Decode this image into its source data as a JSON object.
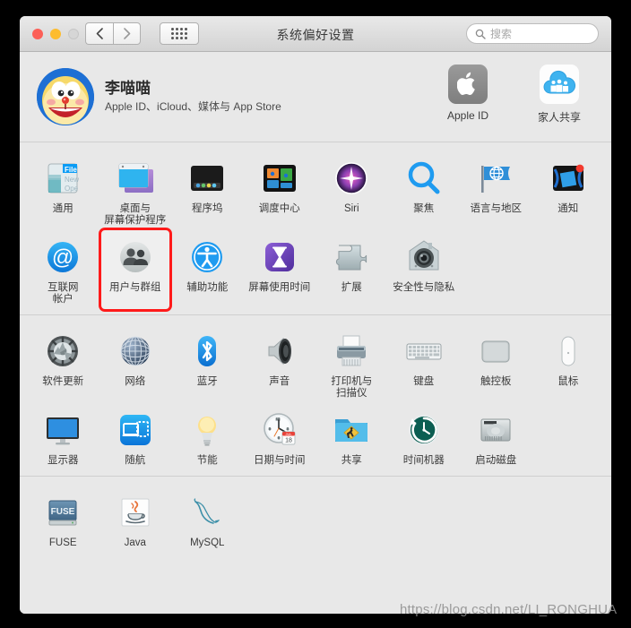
{
  "window": {
    "title": "系统偏好设置",
    "traffic_lights": [
      "close",
      "minimize",
      "zoom"
    ],
    "nav": {
      "back": "‹",
      "forward": "›",
      "grid": "show-all"
    },
    "search": {
      "placeholder": "搜索",
      "value": ""
    }
  },
  "account": {
    "name": "李喵喵",
    "subtitle": "Apple ID、iCloud、媒体与 App Store",
    "buttons": [
      {
        "label": "Apple ID",
        "icon": "apple-logo-icon"
      },
      {
        "label": "家人共享",
        "icon": "family-sharing-cloud-icon"
      }
    ]
  },
  "sections": [
    {
      "name": "personal",
      "items": [
        {
          "label": "通用",
          "icon": "general-icon",
          "highlight": false
        },
        {
          "label": "桌面与\n屏幕保护程序",
          "icon": "desktop-screensaver-icon",
          "highlight": false
        },
        {
          "label": "程序坞",
          "icon": "dock-icon",
          "highlight": false
        },
        {
          "label": "调度中心",
          "icon": "mission-control-icon",
          "highlight": false
        },
        {
          "label": "Siri",
          "icon": "siri-icon",
          "highlight": false
        },
        {
          "label": "聚焦",
          "icon": "spotlight-icon",
          "highlight": false
        },
        {
          "label": "语言与地区",
          "icon": "language-region-icon",
          "highlight": false
        },
        {
          "label": "通知",
          "icon": "notifications-icon",
          "highlight": false
        },
        {
          "label": "互联网\n帐户",
          "icon": "internet-accounts-icon",
          "highlight": false
        },
        {
          "label": "用户与群组",
          "icon": "users-groups-icon",
          "highlight": true
        },
        {
          "label": "辅助功能",
          "icon": "accessibility-icon",
          "highlight": false
        },
        {
          "label": "屏幕使用时间",
          "icon": "screen-time-icon",
          "highlight": false
        },
        {
          "label": "扩展",
          "icon": "extensions-icon",
          "highlight": false
        },
        {
          "label": "安全性与隐私",
          "icon": "security-privacy-icon",
          "highlight": false
        }
      ]
    },
    {
      "name": "hardware",
      "items": [
        {
          "label": "软件更新",
          "icon": "software-update-icon",
          "highlight": false
        },
        {
          "label": "网络",
          "icon": "network-icon",
          "highlight": false
        },
        {
          "label": "蓝牙",
          "icon": "bluetooth-icon",
          "highlight": false
        },
        {
          "label": "声音",
          "icon": "sound-icon",
          "highlight": false
        },
        {
          "label": "打印机与\n扫描仪",
          "icon": "printers-scanners-icon",
          "highlight": false
        },
        {
          "label": "键盘",
          "icon": "keyboard-icon",
          "highlight": false
        },
        {
          "label": "触控板",
          "icon": "trackpad-icon",
          "highlight": false
        },
        {
          "label": "鼠标",
          "icon": "mouse-icon",
          "highlight": false
        },
        {
          "label": "显示器",
          "icon": "displays-icon",
          "highlight": false
        },
        {
          "label": "随航",
          "icon": "sidecar-icon",
          "highlight": false
        },
        {
          "label": "节能",
          "icon": "energy-saver-icon",
          "highlight": false
        },
        {
          "label": "日期与时间",
          "icon": "date-time-icon",
          "highlight": false
        },
        {
          "label": "共享",
          "icon": "sharing-icon",
          "highlight": false
        },
        {
          "label": "时间机器",
          "icon": "time-machine-icon",
          "highlight": false
        },
        {
          "label": "启动磁盘",
          "icon": "startup-disk-icon",
          "highlight": false
        }
      ]
    },
    {
      "name": "third-party",
      "items": [
        {
          "label": "FUSE",
          "icon": "fuse-icon",
          "highlight": false
        },
        {
          "label": "Java",
          "icon": "java-icon",
          "highlight": false
        },
        {
          "label": "MySQL",
          "icon": "mysql-icon",
          "highlight": false
        }
      ]
    }
  ],
  "date_time_icon": {
    "month": "JUL",
    "day": "18"
  },
  "watermark": "https://blog.csdn.net/LI_RONGHUA",
  "colors": {
    "window_bg": "#e8e8e8",
    "titlebar_top": "#e9e9e9",
    "titlebar_bottom": "#d3d3d3",
    "highlight_outline": "#ff1a1a",
    "accent_blue": "#1f9bf0",
    "close_red": "#fc5f57",
    "minimize_yellow": "#fdbc2e",
    "zoom_gray": "#d6d6d6"
  }
}
